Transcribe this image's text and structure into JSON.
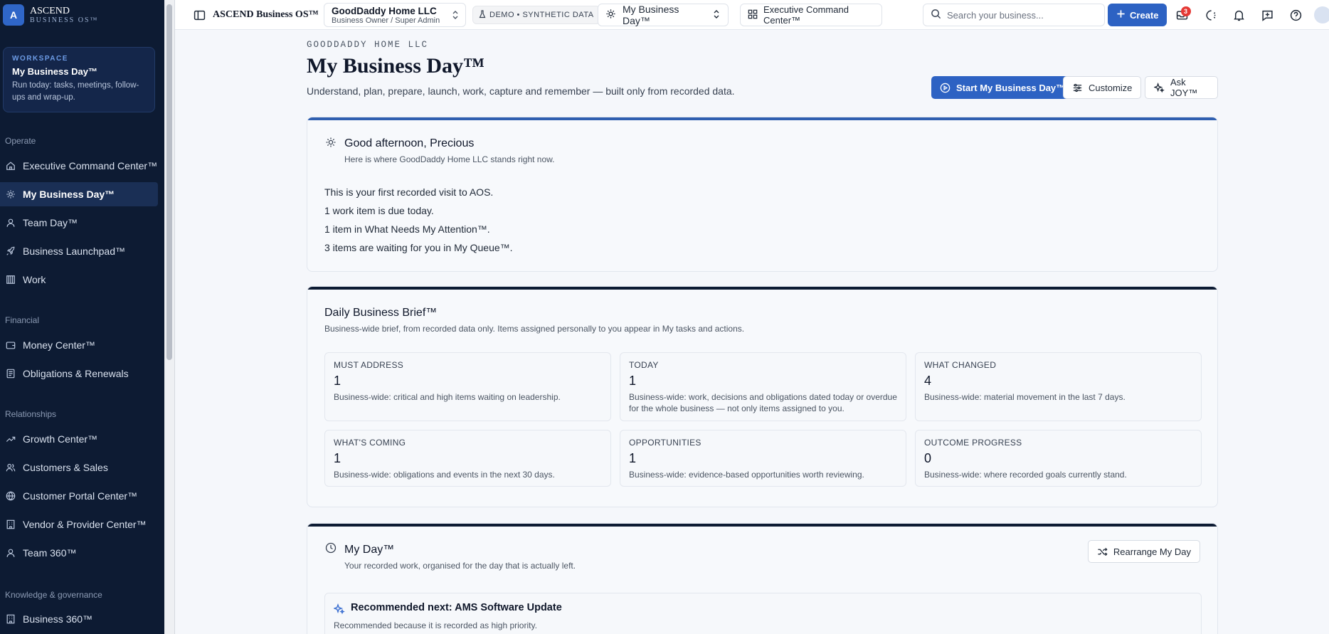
{
  "sidebar": {
    "logo_letter": "A",
    "brand_name": "ASCEND",
    "brand_sub": "BUSINESS OS™",
    "workspace": {
      "label": "WORKSPACE",
      "title": "My Business Day™",
      "description": "Run today: tasks, meetings, follow-ups and wrap-up."
    },
    "sections": [
      {
        "title": "Operate"
      },
      {
        "title": "Financial"
      },
      {
        "title": "Relationships"
      },
      {
        "title": "Knowledge & governance"
      }
    ],
    "items": [
      {
        "label": "Executive Command Center™",
        "icon": "home-icon"
      },
      {
        "label": "My Business Day™",
        "icon": "sun-icon",
        "active": true
      },
      {
        "label": "Team Day™",
        "icon": "user-icon"
      },
      {
        "label": "Business Launchpad™",
        "icon": "rocket-icon"
      },
      {
        "label": "Work",
        "icon": "briefcase-icon"
      },
      {
        "label": "Money Center™",
        "icon": "wallet-icon"
      },
      {
        "label": "Obligations & Renewals",
        "icon": "document-icon"
      },
      {
        "label": "Growth Center™",
        "icon": "trending-up-icon"
      },
      {
        "label": "Customers & Sales",
        "icon": "users-icon"
      },
      {
        "label": "Customer Portal Center™",
        "icon": "globe-icon"
      },
      {
        "label": "Vendor & Provider Center™",
        "icon": "building-icon"
      },
      {
        "label": "Team 360™",
        "icon": "user-icon"
      },
      {
        "label": "Business 360™",
        "icon": "building-icon"
      }
    ]
  },
  "topbar": {
    "app_title": "ASCEND Business OS™",
    "org_name": "GoodDaddy Home LLC",
    "org_role": "Business Owner / Super Admin",
    "demo_badge": "DEMO • SYNTHETIC DATA",
    "workspace_select": "My Business Day™",
    "command_center": "Executive Command Center™",
    "search_placeholder": "Search your business...",
    "create_label": "Create",
    "inbox_count": "3"
  },
  "page": {
    "org_label": "GOODDADDY HOME LLC",
    "title": "My Business Day™",
    "subtitle": "Understand, plan, prepare, launch, work, capture and remember — built only from recorded data.",
    "buttons": {
      "start": "Start My Business Day™",
      "customize": "Customize",
      "ask_joy": "Ask JOY™"
    }
  },
  "greeting": {
    "title": "Good afternoon, Precious",
    "subtitle": "Here is where GoodDaddy Home LLC stands right now.",
    "lines": [
      "This is your first recorded visit to AOS.",
      "1 work item is due today.",
      "1 item in What Needs My Attention™.",
      "3 items are waiting for you in My Queue™."
    ]
  },
  "brief": {
    "title": "Daily Business Brief™",
    "subtitle": "Business-wide brief, from recorded data only. Items assigned personally to you appear in My tasks and actions.",
    "stats": [
      {
        "label": "MUST ADDRESS",
        "value": "1",
        "desc": "Business-wide: critical and high items waiting on leadership."
      },
      {
        "label": "TODAY",
        "value": "1",
        "desc": "Business-wide: work, decisions and obligations dated today or overdue for the whole business — not only items assigned to you."
      },
      {
        "label": "WHAT CHANGED",
        "value": "4",
        "desc": "Business-wide: material movement in the last 7 days."
      },
      {
        "label": "WHAT'S COMING",
        "value": "1",
        "desc": "Business-wide: obligations and events in the next 30 days."
      },
      {
        "label": "OPPORTUNITIES",
        "value": "1",
        "desc": "Business-wide: evidence-based opportunities worth reviewing."
      },
      {
        "label": "OUTCOME PROGRESS",
        "value": "0",
        "desc": "Business-wide: where recorded goals currently stand."
      }
    ]
  },
  "myday": {
    "title": "My Day™",
    "subtitle": "Your recorded work, organised for the day that is actually left.",
    "rearrange": "Rearrange My Day",
    "recommended_title": "Recommended next: AMS Software Update",
    "recommended_sub": "Recommended because it is recorded as high priority."
  },
  "colors": {
    "sidebar_bg": "#0d1b33",
    "accent": "#2d62c3",
    "badge_red": "#e53935"
  }
}
